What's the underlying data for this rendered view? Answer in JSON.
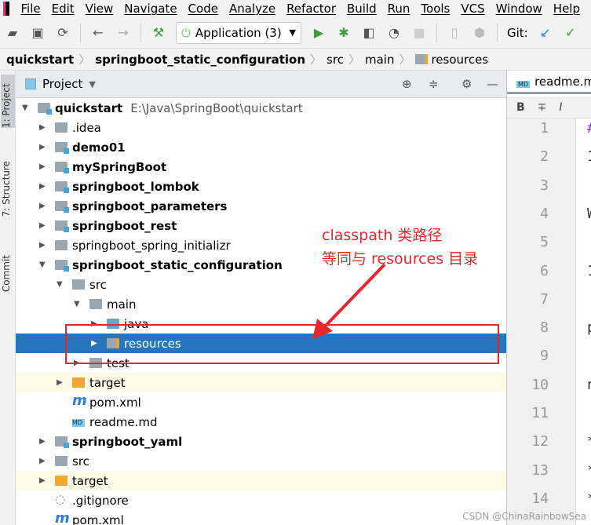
{
  "menu": [
    "File",
    "Edit",
    "View",
    "Navigate",
    "Code",
    "Analyze",
    "Refactor",
    "Build",
    "Run",
    "Tools",
    "VCS",
    "Window",
    "Help"
  ],
  "toolbar": {
    "run_config": "Application (3)",
    "git_label": "Git:"
  },
  "breadcrumb": [
    "quickstart",
    "springboot_static_configuration",
    "src",
    "main",
    "resources"
  ],
  "side_tabs": [
    "1: Project",
    "7: Structure",
    "Commit"
  ],
  "project_panel": {
    "title": "Project"
  },
  "tree": [
    {
      "label": "quickstart",
      "path": "E:\\Java\\SpringBoot\\quickstart",
      "level": 0,
      "arrow": "down",
      "icon": "module-folder",
      "bold": true
    },
    {
      "label": ".idea",
      "level": 1,
      "arrow": "right",
      "icon": "folder"
    },
    {
      "label": "demo01",
      "level": 1,
      "arrow": "right",
      "icon": "module-folder",
      "bold": true
    },
    {
      "label": "mySpringBoot",
      "level": 1,
      "arrow": "right",
      "icon": "module-folder",
      "bold": true
    },
    {
      "label": "springboot_lombok",
      "level": 1,
      "arrow": "right",
      "icon": "module-folder",
      "bold": true
    },
    {
      "label": "springboot_parameters",
      "level": 1,
      "arrow": "right",
      "icon": "module-folder",
      "bold": true
    },
    {
      "label": "springboot_rest",
      "level": 1,
      "arrow": "right",
      "icon": "module-folder",
      "bold": true
    },
    {
      "label": "springboot_spring_initializr",
      "level": 1,
      "arrow": "right",
      "icon": "folder"
    },
    {
      "label": "springboot_static_configuration",
      "level": 1,
      "arrow": "down",
      "icon": "module-folder",
      "bold": true
    },
    {
      "label": "src",
      "level": 2,
      "arrow": "down",
      "icon": "folder"
    },
    {
      "label": "main",
      "level": 3,
      "arrow": "down",
      "icon": "folder"
    },
    {
      "label": "java",
      "level": 4,
      "arrow": "right",
      "icon": "source-folder"
    },
    {
      "label": "resources",
      "level": 4,
      "arrow": "right",
      "icon": "resources-folder",
      "selected": true
    },
    {
      "label": "test",
      "level": 3,
      "arrow": "right",
      "icon": "folder"
    },
    {
      "label": "target",
      "level": 2,
      "arrow": "right",
      "icon": "excluded-folder",
      "excluded": true
    },
    {
      "label": "pom.xml",
      "level": 2,
      "icon": "maven-file"
    },
    {
      "label": "readme.md",
      "level": 2,
      "icon": "markdown-file"
    },
    {
      "label": "springboot_yaml",
      "level": 1,
      "arrow": "right",
      "icon": "module-folder",
      "bold": true
    },
    {
      "label": "src",
      "level": 1,
      "arrow": "right",
      "icon": "folder"
    },
    {
      "label": "target",
      "level": 1,
      "arrow": "right",
      "icon": "excluded-folder",
      "excluded": true
    },
    {
      "label": ".gitignore",
      "level": 1,
      "icon": "gitignore-file"
    },
    {
      "label": "pom.xml",
      "level": 1,
      "icon": "maven-file"
    }
  ],
  "editor": {
    "tab": "readme.m",
    "toolbar": [
      "B",
      "∓",
      "I"
    ],
    "line_numbers": [
      "1",
      "2",
      "3",
      "4",
      "5",
      "6",
      "7",
      "8",
      "9",
      "10",
      "11",
      "12",
      "13",
      "14"
    ],
    "code_fragments": [
      "#",
      "1",
      "",
      "W",
      "",
      "1",
      "",
      "p",
      "",
      "n",
      "",
      "*",
      "*",
      "*"
    ]
  },
  "annotation": {
    "line1": "classpath 类路径",
    "line2": "等同与 resources 目录",
    "color": "#e8272c"
  },
  "watermark": "CSDN @ChinaRainbowSea",
  "colors": {
    "selection": "#2675bf",
    "accent": "#e8272c"
  }
}
